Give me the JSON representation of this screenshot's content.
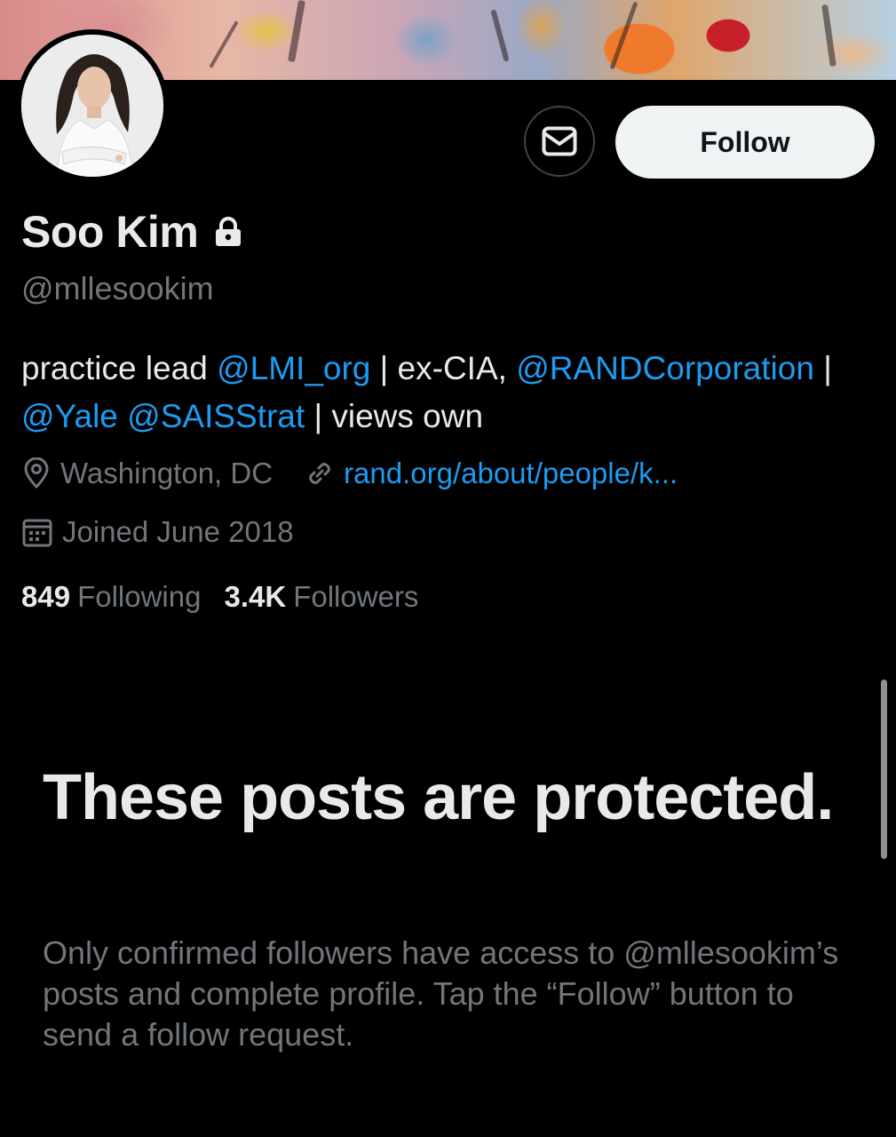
{
  "profile": {
    "name": "Soo Kim",
    "handle": "@mllesookim",
    "bio": {
      "p1": "practice lead ",
      "l1": "@LMI_org",
      "p2": " | ex-CIA, ",
      "l2": "@RANDCorporation",
      "p3": " |",
      "l3": "@Yale",
      "p4": " ",
      "l4": "@SAISStrat",
      "p5": " | views own"
    },
    "location": "Washington, DC",
    "website": "rand.org/about/people/k...",
    "joined": "Joined June 2018",
    "following_count": "849",
    "following_label": "Following",
    "followers_count": "3.4K",
    "followers_label": "Followers"
  },
  "actions": {
    "follow_label": "Follow",
    "message_icon": "mail-icon"
  },
  "protected": {
    "title": "These posts are protected.",
    "description": "Only confirmed followers have access to @mllesookim’s posts and complete profile. Tap the “Follow” button to send a follow request."
  },
  "colors": {
    "background": "#000000",
    "link": "#1d9bf0",
    "secondary_text": "#71767b",
    "primary_text": "#e7e9ea",
    "follow_button_bg": "#eff3f4"
  },
  "icons": [
    "lock-icon",
    "location-pin-icon",
    "link-icon",
    "calendar-icon",
    "mail-icon"
  ]
}
